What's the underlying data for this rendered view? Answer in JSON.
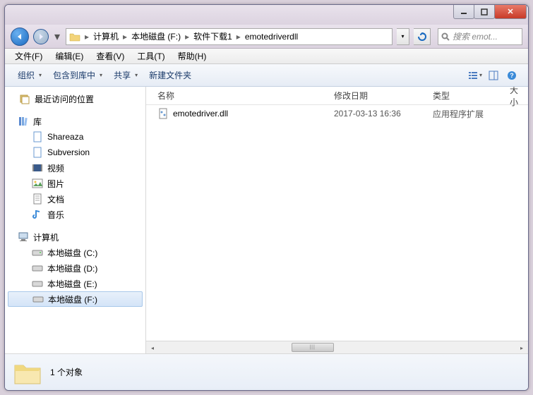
{
  "breadcrumbs": [
    "计算机",
    "本地磁盘 (F:)",
    "软件下载1",
    "emotedriverdll"
  ],
  "search_placeholder": "搜索 emot...",
  "menus": {
    "file": "文件(F)",
    "edit": "编辑(E)",
    "view": "查看(V)",
    "tools": "工具(T)",
    "help": "帮助(H)"
  },
  "toolbar": {
    "organize": "组织",
    "include": "包含到库中",
    "share": "共享",
    "newfolder": "新建文件夹"
  },
  "tree": {
    "recent": "最近访问的位置",
    "libraries": "库",
    "lib_items": [
      "Shareaza",
      "Subversion",
      "视频",
      "图片",
      "文档",
      "音乐"
    ],
    "computer": "计算机",
    "drives": [
      "本地磁盘 (C:)",
      "本地磁盘 (D:)",
      "本地磁盘 (E:)",
      "本地磁盘 (F:)"
    ]
  },
  "columns": {
    "name": "名称",
    "date": "修改日期",
    "type": "类型",
    "size": "大小"
  },
  "files": [
    {
      "name": "emotedriver.dll",
      "date": "2017-03-13 16:36",
      "type": "应用程序扩展"
    }
  ],
  "status": "1 个对象"
}
